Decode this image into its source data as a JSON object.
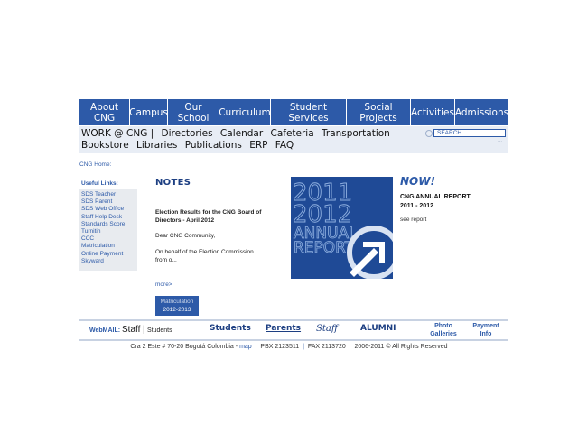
{
  "nav": {
    "items": [
      {
        "label": "About\nCNG"
      },
      {
        "label": "Campus"
      },
      {
        "label": "Our\nSchool"
      },
      {
        "label": "Curriculum"
      },
      {
        "label": "Student\nServices"
      },
      {
        "label": "Social\nProjects"
      },
      {
        "label": "Activities"
      },
      {
        "label": "Admissions"
      }
    ]
  },
  "subnav": {
    "links": [
      "WORK @ CNG |",
      "Directories",
      "Calendar",
      "Cafeteria",
      "Transportation",
      "Bookstore",
      "Libraries",
      "Publications",
      "ERP",
      "FAQ"
    ],
    "search_placeholder": "SEARCH"
  },
  "breadcrumb": "CNG Home:",
  "useful_links": {
    "title": "Useful Links:",
    "items": [
      "SDS Teacher",
      "SDS Parent",
      "SDS Web Office",
      "Staff Help Desk",
      "Standards Score",
      "Turnitin",
      "CCC",
      "Matriculation",
      "Online Payment",
      "Skyward"
    ]
  },
  "notes": {
    "title": "NOTES",
    "heading": "Election Results for the CNG Board of Directors - April 2012",
    "greeting": "Dear CNG Community,",
    "body": "On behalf of the Election Commission from o...",
    "more": "more>"
  },
  "matriculation": {
    "line1": "Matriculation",
    "line2": "2012-2013"
  },
  "report_image": {
    "year1": "2011",
    "year2": "2012",
    "word1": "ANNUAL",
    "word2": "REPORT"
  },
  "now": {
    "title": "NOW!",
    "report_title": "CNG ANNUAL REPORT\n2011 - 2012",
    "see_report": "see report"
  },
  "footer": {
    "webmail_label": "WebMAIL:",
    "webmail_staff": "Staff",
    "webmail_sep": "|",
    "webmail_students": "Students",
    "students": "Students",
    "parents": "Parents",
    "staff": "Staff",
    "alumni": "ALUMNI",
    "photo_galleries": "Photo\nGalleries",
    "payment_info": "Payment\nInfo"
  },
  "address": {
    "text": "Cra 2 Este # 70-20 Bogotá Colombia -",
    "map": "map",
    "pbx": "PBX 2123511",
    "fax": "FAX 2113720",
    "rights": "2006-2011 © All Rights Reserved"
  },
  "colors": {
    "brand_blue": "#2d5aa8",
    "dark_blue": "#1d3f82",
    "subnav_bg": "#e8edf5"
  }
}
